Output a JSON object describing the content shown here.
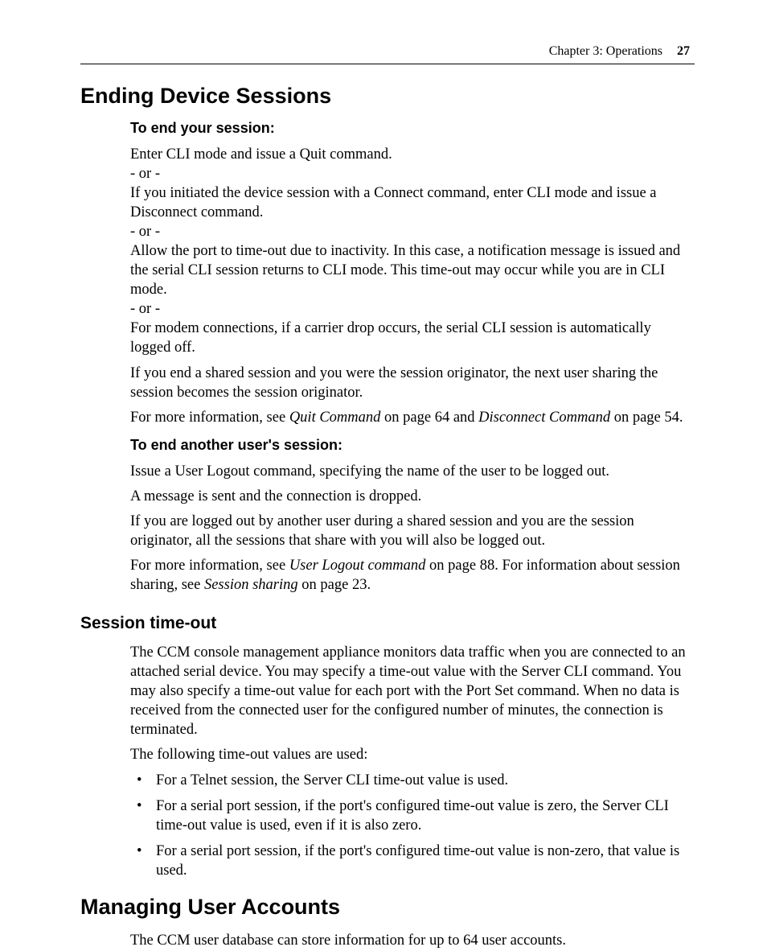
{
  "header": {
    "chapter": "Chapter 3: Operations",
    "page": "27"
  },
  "sections": {
    "ending": {
      "title": "Ending Device Sessions",
      "sub1_title": "To end your session:",
      "p1": "Enter CLI mode and issue a Quit command.",
      "or1": "- or -",
      "p2": "If you initiated the device session with a Connect command, enter CLI mode and issue a Disconnect command.",
      "or2": "- or -",
      "p3": "Allow the port to time-out due to inactivity. In this case, a notification message is issued and the serial CLI session returns to CLI mode. This time-out may occur while you are in CLI mode.",
      "or3": "- or -",
      "p4": "For modem connections, if a carrier drop occurs, the serial CLI session is automatically logged off.",
      "p5": "If you end a shared session and you were the session originator, the next user sharing the session becomes the session originator.",
      "p6a": "For more information, see ",
      "p6i1": "Quit Command",
      "p6b": " on page 64 and ",
      "p6i2": "Disconnect Command",
      "p6c": " on page 54.",
      "sub2_title": "To end another user's session:",
      "p7": "Issue a User Logout command, specifying the name of the user to be logged out.",
      "p8": "A message is sent and the connection is dropped.",
      "p9": "If you are logged out by another user during a shared session and you are the session originator, all the sessions that share with you will also be logged out.",
      "p10a": "For more information, see ",
      "p10i1": "User Logout command",
      "p10b": " on page 88. For information about session sharing, see ",
      "p10i2": "Session sharing",
      "p10c": " on page 23."
    },
    "timeout": {
      "title": "Session time-out",
      "p1": "The CCM console management appliance monitors data traffic when you are connected to an attached serial device. You may specify a time-out value with the Server CLI command. You may also specify a time-out value for each port with the Port Set command. When no data is received from the connected user for the configured number of minutes, the connection is terminated.",
      "p2": "The following time-out values are used:",
      "b1": "For a Telnet session, the Server CLI time-out value is used.",
      "b2": "For a serial port session, if the port's configured time-out value is zero, the Server CLI time-out value is used, even if it is also zero.",
      "b3": "For a serial port session, if the port's configured time-out value is non-zero, that value is used."
    },
    "accounts": {
      "title": "Managing User Accounts",
      "p1": "The CCM user database can store information for up to 64 user accounts."
    }
  }
}
